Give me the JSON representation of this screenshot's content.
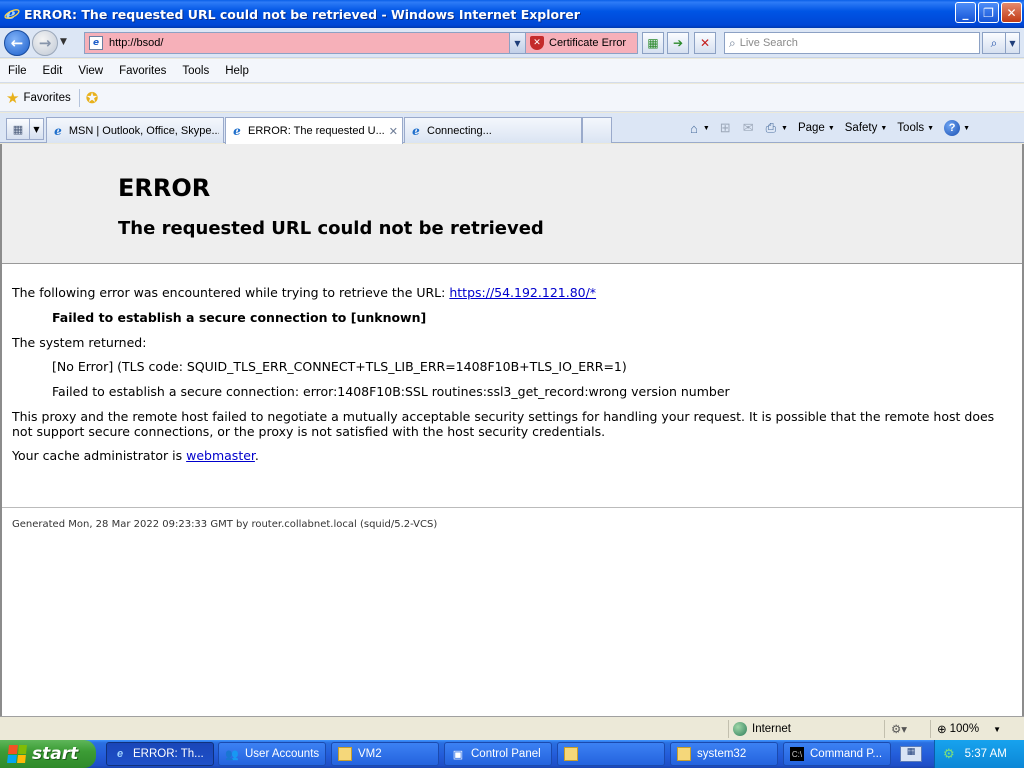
{
  "window": {
    "title": "ERROR: The requested URL could not be retrieved - Windows Internet Explorer"
  },
  "nav": {
    "url": "http://bsod/",
    "cert_error": "Certificate Error",
    "search_placeholder": "Live Search"
  },
  "menu": [
    "File",
    "Edit",
    "View",
    "Favorites",
    "Tools",
    "Help"
  ],
  "favorites": {
    "label": "Favorites"
  },
  "tabs": [
    {
      "label": "MSN | Outlook, Office, Skype..."
    },
    {
      "label": "ERROR: The requested U..."
    },
    {
      "label": "Connecting..."
    }
  ],
  "commands": {
    "page": "Page",
    "safety": "Safety",
    "tools": "Tools"
  },
  "page": {
    "h1": "ERROR",
    "h2": "The requested URL could not be retrieved",
    "p1_text": "The following error was encountered while trying to retrieve the URL: ",
    "p1_link": "https://54.192.121.80/*",
    "failed": "Failed to establish a secure connection to [unknown]",
    "system_returned": "The system returned:",
    "no_error": "[No Error] (TLS code: SQUID_TLS_ERR_CONNECT+TLS_LIB_ERR=1408F10B+TLS_IO_ERR=1)",
    "failed_detail": "Failed to establish a secure connection: error:1408F10B:SSL routines:ssl3_get_record:wrong version number",
    "proxy_text": "This proxy and the remote host failed to negotiate a mutually acceptable security settings for handling your request. It is possible that the remote host does not support secure connections, or the proxy is not satisfied with the host security credentials.",
    "admin_text": "Your cache administrator is ",
    "admin_link": "webmaster",
    "admin_end": ".",
    "footer": "Generated Mon, 28 Mar 2022 09:23:33 GMT by router.collabnet.local (squid/5.2-VCS)"
  },
  "status": {
    "zone": "Internet",
    "zoom": "100%"
  },
  "taskbar": {
    "start": "start",
    "items": [
      "ERROR: Th...",
      "User Accounts",
      "VM2",
      "Control Panel",
      "",
      "system32",
      "Command P..."
    ],
    "clock": "5:37 AM"
  }
}
